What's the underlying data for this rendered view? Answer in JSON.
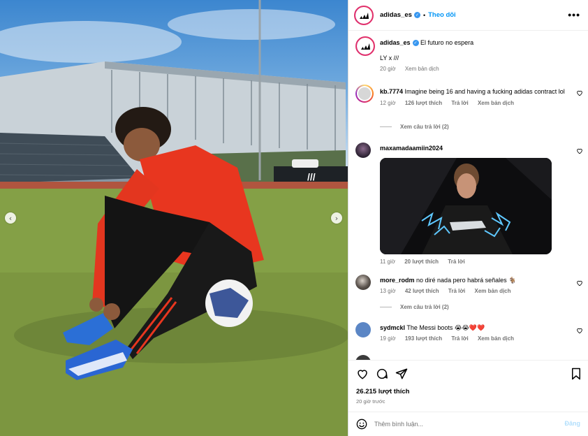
{
  "media": {
    "prev_icon": "chevron-left-icon",
    "next_icon": "chevron-right-icon"
  },
  "header": {
    "username": "adidas_es",
    "separator": "•",
    "follow_label": "Theo dõi",
    "more_icon": "more-horizontal-icon"
  },
  "caption": {
    "username": "adidas_es",
    "text_line1": "El futuro no espera",
    "text_line2": "LY x ///",
    "time": "20 giờ",
    "translate": "Xem bản dịch"
  },
  "comments": [
    {
      "username": "kb.7774",
      "text": "Imagine being 16 and having a fucking adidas contract lol",
      "time": "12 giờ",
      "likes": "126 lượt thích",
      "reply": "Trả lời",
      "translate": "Xem bản dịch",
      "view_replies": "Xem câu trả lời (2)"
    },
    {
      "username": "maxamadaamiin2024",
      "text": "",
      "time": "11 giờ",
      "likes": "20 lượt thích",
      "reply": "Trả lời"
    },
    {
      "username": "more_rodm",
      "text": "no diré nada pero habrá señales 🐐",
      "time": "13 giờ",
      "likes": "42 lượt thích",
      "reply": "Trả lời",
      "translate": "Xem bản dịch",
      "view_replies": "Xem câu trả lời (2)"
    },
    {
      "username": "sydmckl",
      "text": "The Messi boots 😭😭❤️❤️",
      "time": "19 giờ",
      "likes": "193 lượt thích",
      "reply": "Trả lời",
      "translate": "Xem bản dịch"
    }
  ],
  "actions": {
    "likes": "26.215 lượt thích",
    "time": "20 giờ trước"
  },
  "composer": {
    "placeholder": "Thêm bình luận...",
    "post_label": "Đăng"
  },
  "colors": {
    "accent": "#0095f6",
    "verified": "#3897f0",
    "muted": "#737373",
    "jersey": "#e8361f"
  }
}
